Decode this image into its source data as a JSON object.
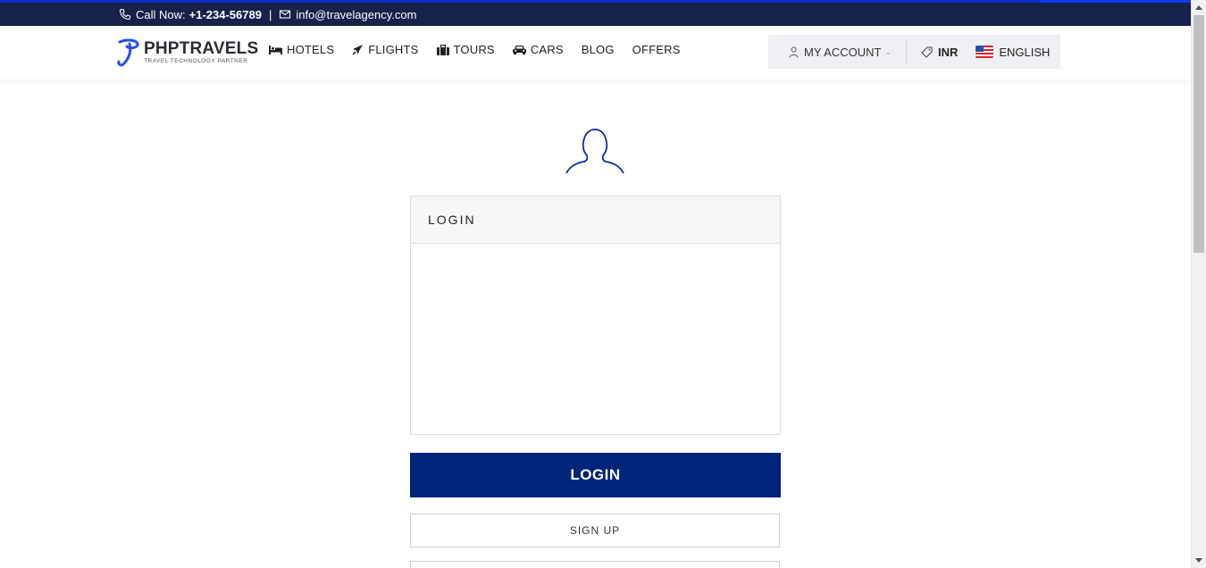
{
  "topbar": {
    "call_label": "Call Now:",
    "phone": "+1-234-56789",
    "separator": "|",
    "email": "info@travelagency.com"
  },
  "brand": {
    "name": "PHPTRAVELS",
    "tagline": "TRAVEL TECHNOLOGY PARTNER"
  },
  "nav": {
    "items": [
      {
        "label": "HOTELS",
        "icon": "bed-icon"
      },
      {
        "label": "FLIGHTS",
        "icon": "plane-icon"
      },
      {
        "label": "TOURS",
        "icon": "suitcase-icon"
      },
      {
        "label": "CARS",
        "icon": "car-icon"
      },
      {
        "label": "BLOG",
        "icon": ""
      },
      {
        "label": "OFFERS",
        "icon": ""
      }
    ]
  },
  "account": {
    "my_account_label": "MY ACCOUNT",
    "currency": "INR",
    "language": "ENGLISH"
  },
  "login": {
    "card_title": "LOGIN",
    "login_button": "LOGIN",
    "signup_button": "SIGN UP"
  },
  "colors": {
    "topbar_bg": "#16224a",
    "primary_button": "#00247a",
    "accent_blue": "#0a3af0"
  }
}
